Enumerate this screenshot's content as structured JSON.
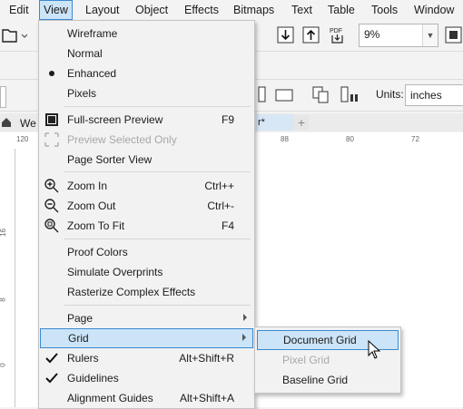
{
  "menubar": {
    "items": [
      "Edit",
      "View",
      "Layout",
      "Object",
      "Effects",
      "Bitmaps",
      "Text",
      "Table",
      "Tools",
      "Window"
    ]
  },
  "toolbar": {
    "zoom_value": "9%"
  },
  "propbar": {
    "units_label": "Units:",
    "units_value": "inches"
  },
  "tabs": {
    "doc_partial": "We",
    "doc_tab_tail": "r*",
    "add": "+"
  },
  "ruler": {
    "h_ticks": [
      "120",
      "88",
      "80",
      "72"
    ],
    "v_ticks": [
      "16",
      "8",
      "0"
    ]
  },
  "view_menu": {
    "items": [
      {
        "label": "Wireframe",
        "shortcut": ""
      },
      {
        "label": "Normal",
        "shortcut": ""
      },
      {
        "label": "Enhanced",
        "shortcut": "",
        "bullet": true
      },
      {
        "label": "Pixels",
        "shortcut": ""
      },
      {
        "label": "Full-screen Preview",
        "shortcut": "F9"
      },
      {
        "label": "Preview Selected Only",
        "shortcut": "",
        "disabled": true
      },
      {
        "label": "Page Sorter View",
        "shortcut": ""
      },
      {
        "label": "Zoom In",
        "shortcut": "Ctrl++"
      },
      {
        "label": "Zoom Out",
        "shortcut": "Ctrl+-"
      },
      {
        "label": "Zoom To Fit",
        "shortcut": "F4"
      },
      {
        "label": "Proof Colors",
        "shortcut": ""
      },
      {
        "label": "Simulate Overprints",
        "shortcut": ""
      },
      {
        "label": "Rasterize Complex Effects",
        "shortcut": ""
      },
      {
        "label": "Page",
        "shortcut": "",
        "submenu": true
      },
      {
        "label": "Grid",
        "shortcut": "",
        "submenu": true,
        "highlighted": true
      },
      {
        "label": "Rulers",
        "shortcut": "Alt+Shift+R",
        "checked": true
      },
      {
        "label": "Guidelines",
        "shortcut": "",
        "checked": true
      },
      {
        "label": "Alignment Guides",
        "shortcut": "Alt+Shift+A"
      }
    ]
  },
  "grid_submenu": {
    "items": [
      {
        "label": "Document Grid",
        "highlighted": true
      },
      {
        "label": "Pixel Grid",
        "disabled": true
      },
      {
        "label": "Baseline Grid"
      }
    ]
  }
}
